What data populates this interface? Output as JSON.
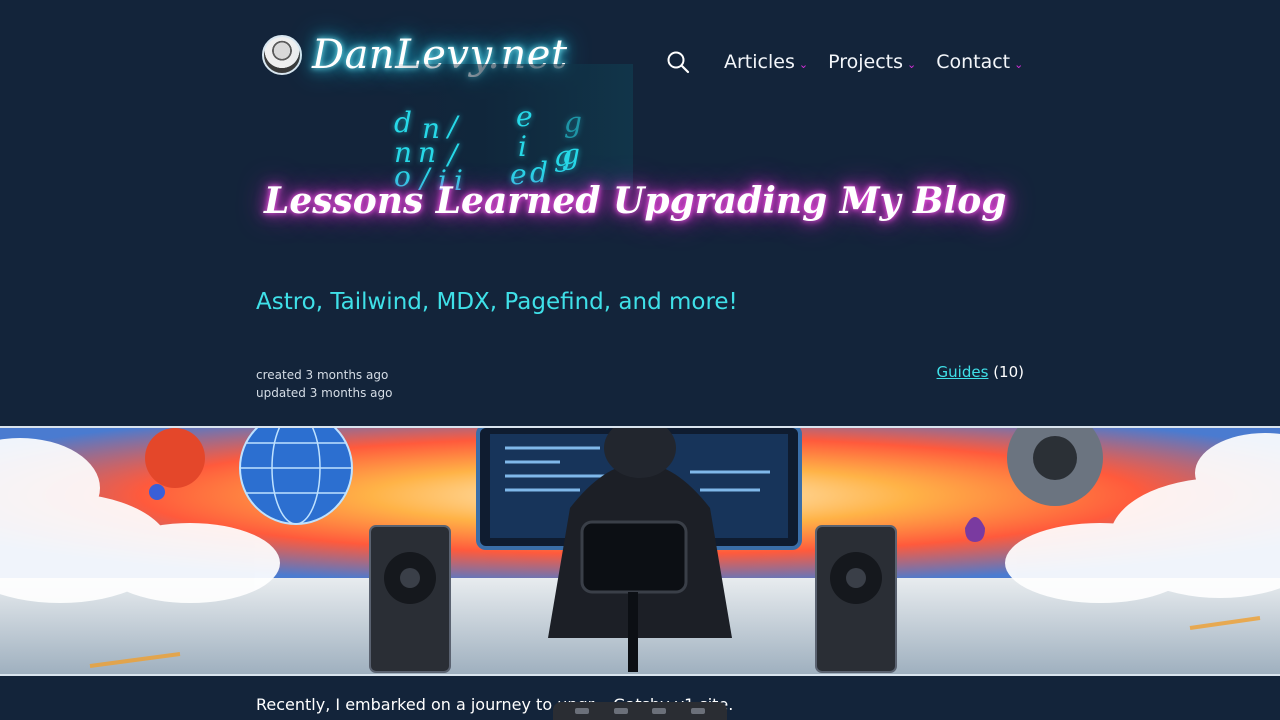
{
  "header": {
    "logo_text": "DanLevy.net",
    "nav": [
      {
        "label": "Articles"
      },
      {
        "label": "Projects"
      },
      {
        "label": "Contact"
      }
    ]
  },
  "hero": {
    "code_glyphs": [
      "d",
      "n",
      "/",
      "e",
      "g",
      "n",
      "n",
      "/",
      "i",
      "g",
      "o",
      "/",
      "i",
      "i",
      "e",
      "d",
      "g"
    ],
    "title": "Lessons Learned Upgrading My Blog",
    "subtitle": "Astro, Tailwind, MDX, Pagefind, and more!",
    "created": "created 3 months ago",
    "updated": "updated 3 months ago",
    "category_link": "Guides",
    "category_count": "(10)"
  },
  "article": {
    "intro": "Recently, I embarked on a journey to upgr... Gatsby v1 site."
  },
  "colors": {
    "background": "#13243a",
    "accent_cyan": "#3fe0e8",
    "accent_magenta": "#d42ed9"
  },
  "icons": [
    "avatar-icon",
    "search-icon",
    "chevron-down-icon"
  ]
}
